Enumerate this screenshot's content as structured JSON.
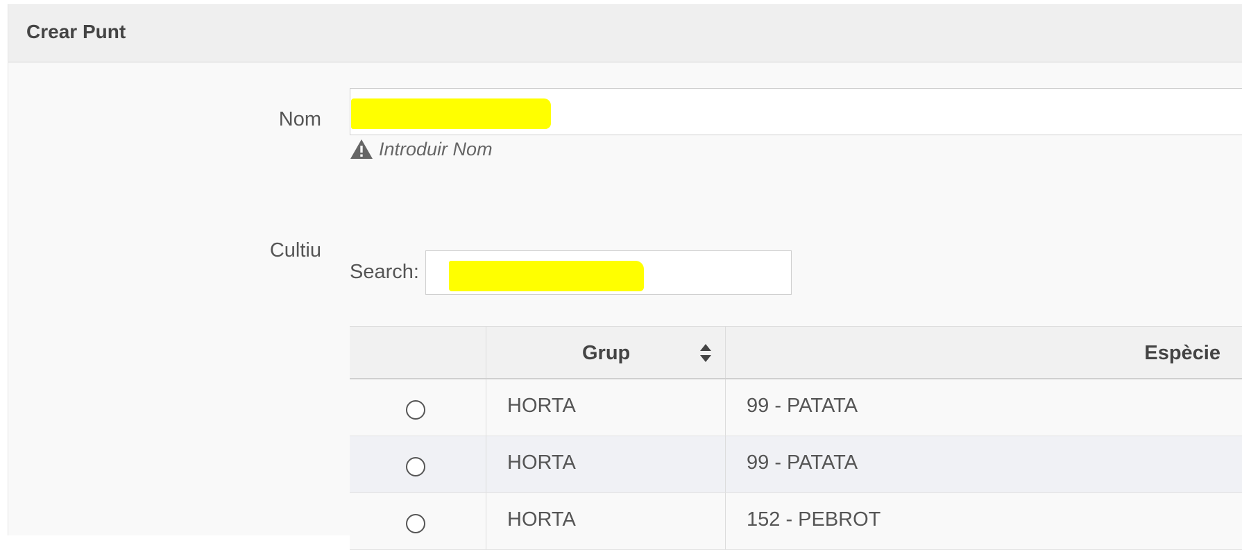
{
  "panel": {
    "title": "Crear Punt"
  },
  "form": {
    "nom_label": "Nom",
    "nom_hint": "Introduir Nom",
    "cultiu_label": "Cultiu",
    "search_label": "Search:"
  },
  "table": {
    "headers": {
      "grup": "Grup",
      "especie": "Espècie"
    },
    "rows": [
      {
        "grup": "HORTA",
        "especie": "99 - PATATA"
      },
      {
        "grup": "HORTA",
        "especie": "99 - PATATA"
      },
      {
        "grup": "HORTA",
        "especie": "152 - PEBROT"
      }
    ]
  },
  "colors": {
    "redaction_highlight": "#ffff00",
    "header_bg": "#efefef",
    "row_alt_bg": "#f0f1f5"
  },
  "icons": {
    "hint": "warning-icon",
    "sort": "sort-icon"
  }
}
